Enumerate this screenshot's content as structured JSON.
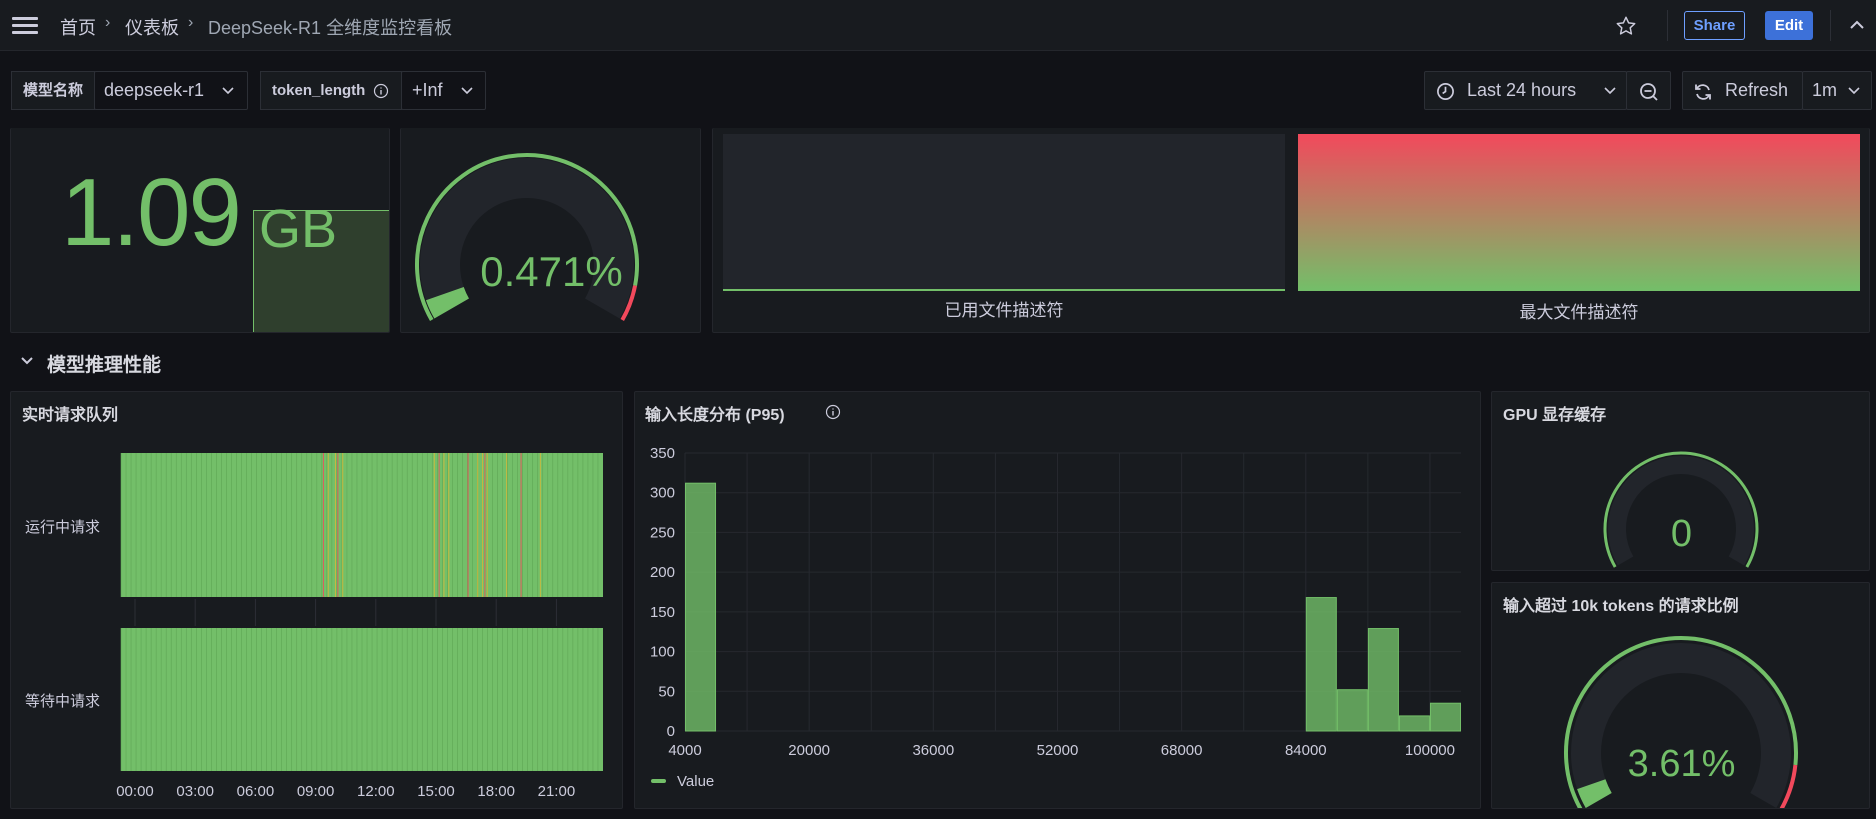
{
  "topbar": {
    "breadcrumb": [
      "首页",
      "仪表板",
      "DeepSeek-R1 全维度监控看板"
    ],
    "share_label": "Share",
    "edit_label": "Edit"
  },
  "variables": [
    {
      "label": "模型名称",
      "value": "deepseek-r1"
    },
    {
      "label": "token_length",
      "value": "+Inf"
    }
  ],
  "time_controls": {
    "range_label": "Last 24 hours",
    "refresh_label": "Refresh",
    "interval_label": "1m"
  },
  "top_row": {
    "memory_stat": {
      "value": "1.09",
      "unit": "GB"
    },
    "gauge": {
      "value": "0.471%",
      "fraction": 0.00471
    },
    "fd_bars": [
      {
        "label": "已用文件描述符",
        "fraction": 0.01
      },
      {
        "label": "最大文件描述符",
        "fraction": 1.0
      }
    ]
  },
  "section": {
    "title": "模型推理性能"
  },
  "queue_panel": {
    "title": "实时请求队列",
    "rows": [
      "运行中请求",
      "等待中请求"
    ],
    "x_ticks": [
      "00:00",
      "03:00",
      "06:00",
      "09:00",
      "12:00",
      "15:00",
      "18:00",
      "21:00"
    ]
  },
  "hist_panel": {
    "title": "输入长度分布 (P95)",
    "legend": "Value"
  },
  "gpu_panel": {
    "title": "GPU 显存缓存",
    "value": "0",
    "fraction": 0
  },
  "ratio_panel": {
    "title": "输入超过 10k tokens 的请求比例",
    "value": "3.61%",
    "fraction": 0.0361
  },
  "colors": {
    "green": "#73bf69",
    "red": "#f2495c",
    "yellow": "#fade2a",
    "bg": "#111217",
    "panel": "#181b1f",
    "accent": "#3d71d9"
  },
  "chart_data": {
    "type": "bar",
    "title": "输入长度分布 (P95)",
    "x_ticks": [
      4000,
      20000,
      36000,
      52000,
      68000,
      84000,
      100000
    ],
    "y_ticks": [
      0,
      50,
      100,
      150,
      200,
      250,
      300,
      350
    ],
    "ylim": [
      0,
      350
    ],
    "xlim": [
      4000,
      104000
    ],
    "series": [
      {
        "name": "Value",
        "bins": [
          {
            "x0": 4000,
            "x1": 8000,
            "value": 312
          },
          {
            "x0": 84000,
            "x1": 88000,
            "value": 168
          },
          {
            "x0": 88000,
            "x1": 92000,
            "value": 52
          },
          {
            "x0": 92000,
            "x1": 96000,
            "value": 129
          },
          {
            "x0": 96000,
            "x1": 100000,
            "value": 19
          },
          {
            "x0": 100000,
            "x1": 104000,
            "value": 35
          }
        ]
      }
    ]
  }
}
